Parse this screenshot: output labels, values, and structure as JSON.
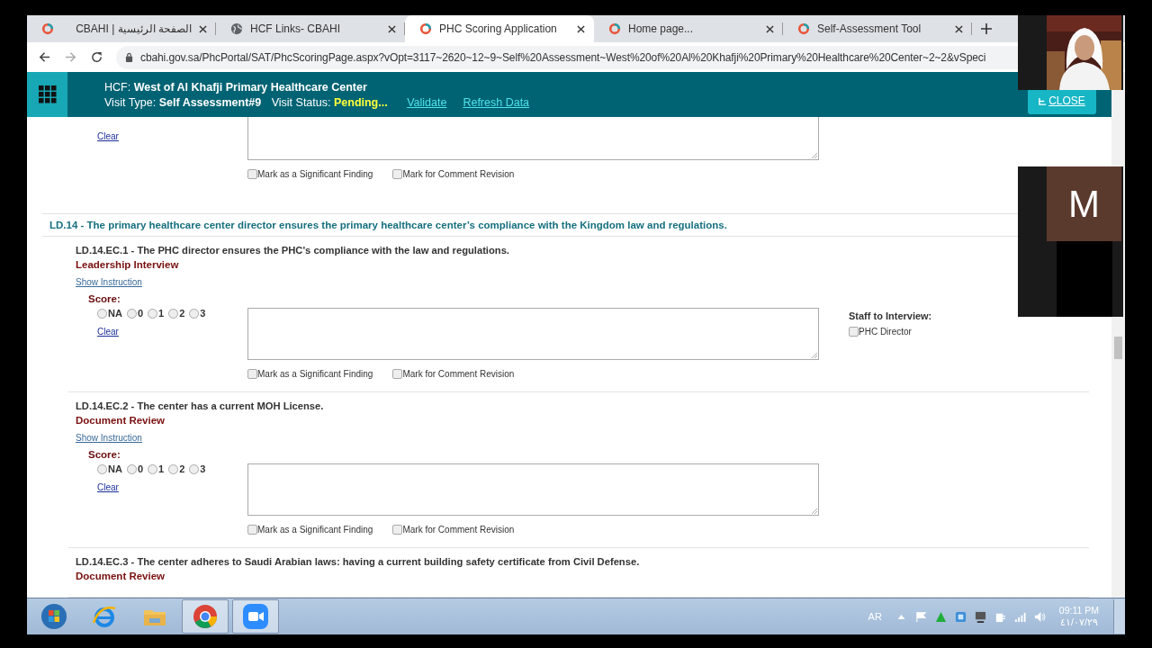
{
  "browser": {
    "tabs": [
      {
        "title": "CBAHI | الصفحة الرئيسية",
        "selected": false
      },
      {
        "title": "HCF Links- CBAHI",
        "selected": false
      },
      {
        "title": "PHC Scoring Application",
        "selected": true
      },
      {
        "title": "Home page...",
        "selected": false
      },
      {
        "title": "Self-Assessment Tool",
        "selected": false
      }
    ],
    "address": "cbahi.gov.sa/PhcPortal/SAT/PhcScoringPage.aspx?vOpt=3117~2620~12~9~Self%20Assessment~West%20of%20Al%20Khafji%20Primary%20Healthcare%20Center~2~2&vSpeci"
  },
  "header": {
    "hcf_label": "HCF:",
    "hcf": "West of Al Khafji Primary Healthcare Center",
    "visit_type_label": "Visit Type:",
    "visit_type": "Self Assessment#9",
    "visit_status_label": "Visit Status:",
    "visit_status": "Pending...",
    "links": [
      "Validate",
      "Refresh Data"
    ],
    "close_button": "CLOSE"
  },
  "items": [
    {
      "kind": "partial",
      "clear": "Clear",
      "flags": [
        {
          "label": "Mark as a Significant Finding",
          "checked": false
        },
        {
          "label": "Mark for Comment Revision",
          "checked": false
        }
      ]
    },
    {
      "kind": "section",
      "title": "LD.14 - The primary healthcare center director ensures the primary healthcare center’s compliance with the Kingdom law and regulations."
    },
    {
      "kind": "standard",
      "title": "LD.14.EC.1 - The PHC director ensures the PHC's compliance with the law and regulations.",
      "method": "Leadership Interview",
      "instruction_link": "Show Instruction",
      "score_label": "Score:",
      "options": [
        {
          "label": "NA",
          "selected": false
        },
        {
          "label": "0",
          "selected": false
        },
        {
          "label": "1",
          "selected": false
        },
        {
          "label": "2",
          "selected": false
        },
        {
          "label": "3",
          "selected": false
        }
      ],
      "clear": "Clear",
      "flags": [
        {
          "label": "Mark as a Significant Finding",
          "checked": false
        },
        {
          "label": "Mark for Comment Revision",
          "checked": false
        }
      ],
      "staff": {
        "title": "Staff to Interview:",
        "members": [
          {
            "label": "PHC Director",
            "checked": false
          }
        ]
      }
    },
    {
      "kind": "standard",
      "title": "LD.14.EC.2 - The center has a current MOH License.",
      "method": "Document Review",
      "instruction_link": "Show Instruction",
      "score_label": "Score:",
      "options": [
        {
          "label": "NA",
          "selected": false
        },
        {
          "label": "0",
          "selected": false
        },
        {
          "label": "1",
          "selected": false
        },
        {
          "label": "2",
          "selected": false
        },
        {
          "label": "3",
          "selected": false
        }
      ],
      "clear": "Clear",
      "flags": [
        {
          "label": "Mark as a Significant Finding",
          "checked": false
        },
        {
          "label": "Mark for Comment Revision",
          "checked": false
        }
      ]
    },
    {
      "kind": "standard",
      "title": "LD.14.EC.3 - The center adheres to Saudi Arabian laws: having a current building safety certificate from Civil Defense.",
      "method": "Document Review"
    }
  ],
  "meeting": {
    "avatar_initial": "M"
  },
  "taskbar": {
    "apps": [
      {
        "kind": "start",
        "selected": false
      },
      {
        "kind": "ie",
        "selected": false
      },
      {
        "kind": "folder",
        "selected": false
      },
      {
        "kind": "chrome",
        "selected": true
      },
      {
        "kind": "zoom",
        "selected": true
      }
    ],
    "language": "AR",
    "time": "09:11 PM",
    "date": "٤١/٠٧/٢٩"
  }
}
